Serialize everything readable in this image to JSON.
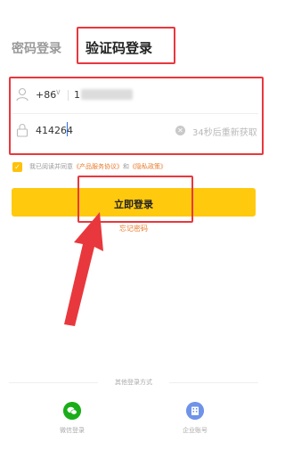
{
  "tabs": {
    "password_login": "密码登录",
    "code_login": "验证码登录"
  },
  "form": {
    "country_code": "+86",
    "phone_prefix": "1",
    "code_value": "414264",
    "resend_label": "34秒后重新获取"
  },
  "agreement": {
    "prefix": "我已阅读并同意",
    "terms": "《产品服务协议》",
    "and": "和",
    "privacy": "《隐私政策》"
  },
  "login_button": "立即登录",
  "forgot_password": "忘记密码",
  "other_methods": {
    "label": "其他登录方式",
    "wechat": "微信登录",
    "enterprise": "企业账号"
  },
  "colors": {
    "accent": "#ffc90d",
    "highlight_border": "#e8383d",
    "link": "#e87b2e"
  }
}
